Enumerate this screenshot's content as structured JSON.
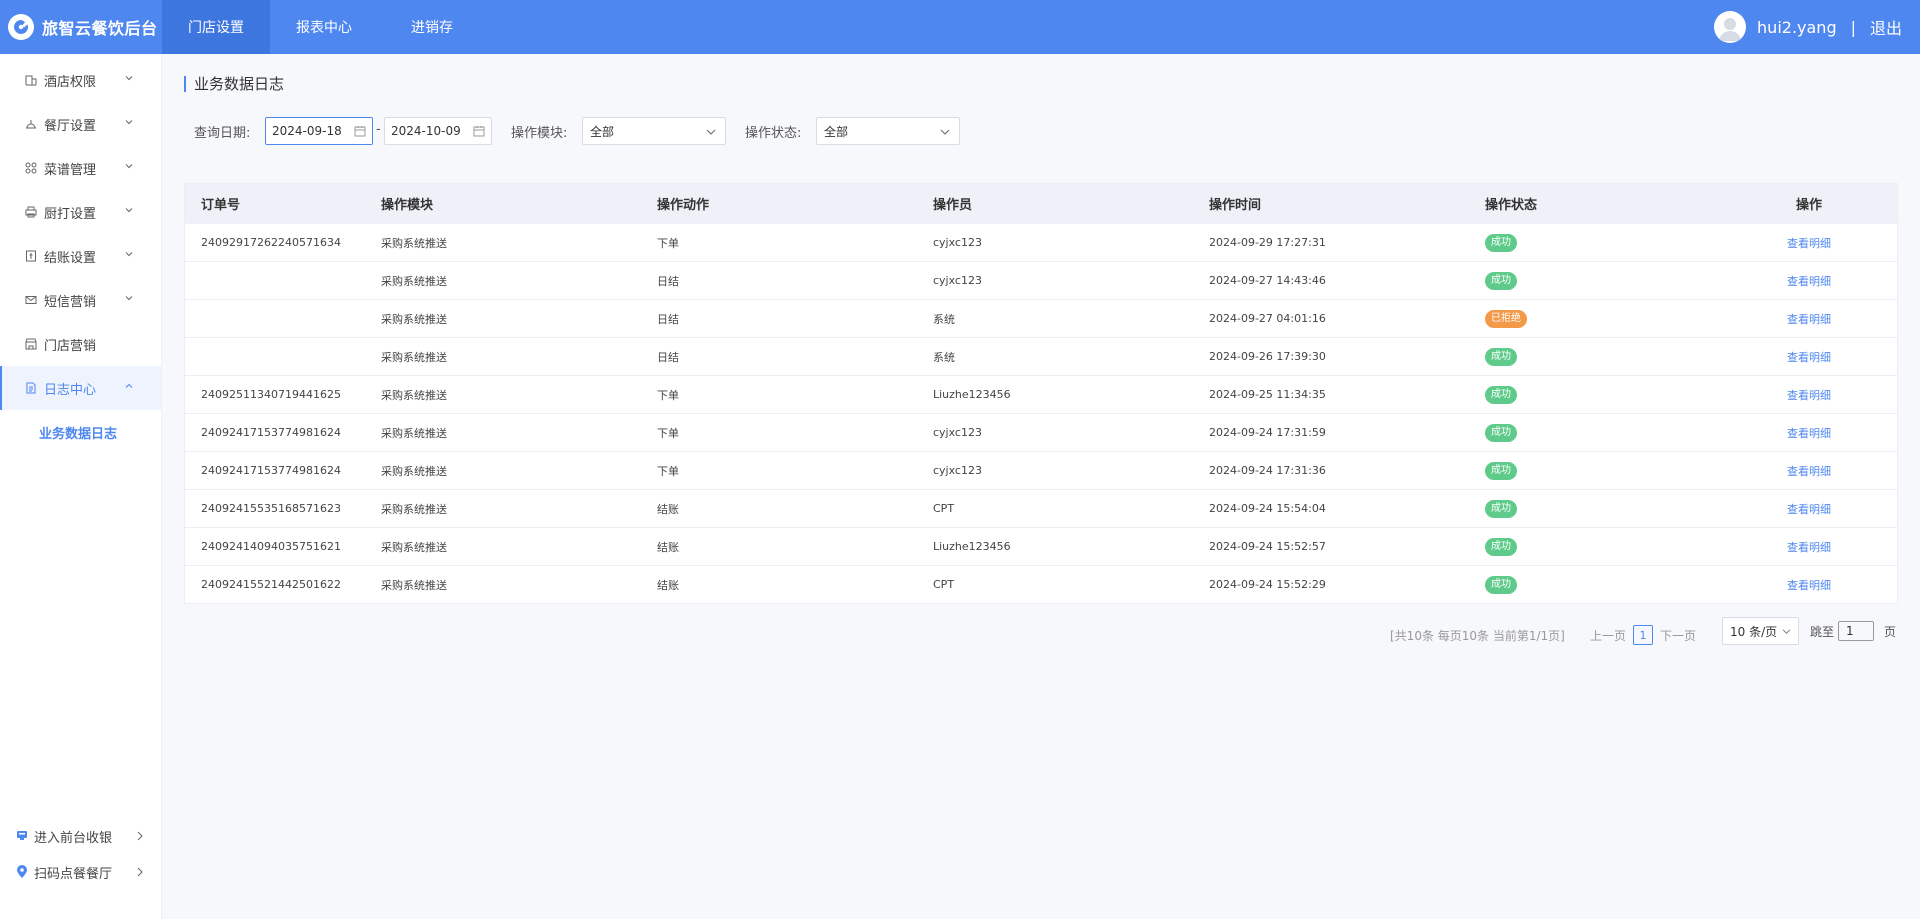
{
  "app": {
    "title": "旅智云餐饮后台"
  },
  "topnav": {
    "tabs": [
      "门店设置",
      "报表中心",
      "进销存"
    ],
    "active_index": 0
  },
  "user": {
    "name": "hui2.yang",
    "separator": "|",
    "logout": "退出"
  },
  "sidebar": {
    "items": [
      {
        "label": "酒店权限",
        "icon": "hotel-icon"
      },
      {
        "label": "餐厅设置",
        "icon": "restaurant-icon"
      },
      {
        "label": "菜谱管理",
        "icon": "menu-grid-icon"
      },
      {
        "label": "厨打设置",
        "icon": "printer-icon"
      },
      {
        "label": "结账设置",
        "icon": "checkout-icon"
      },
      {
        "label": "短信营销",
        "icon": "mail-icon"
      },
      {
        "label": "门店营销",
        "icon": "store-icon"
      },
      {
        "label": "日志中心",
        "icon": "log-icon"
      }
    ],
    "active_sub": "业务数据日志",
    "bottom": [
      {
        "label": "进入前台收银",
        "icon": "cashier-icon"
      },
      {
        "label": "扫码点餐餐厅",
        "icon": "location-pin-icon"
      }
    ]
  },
  "page": {
    "title": "业务数据日志",
    "filters": {
      "date_label": "查询日期:",
      "date_start": "2024-09-18",
      "date_dash": "-",
      "date_end": "2024-10-09",
      "module_label": "操作模块:",
      "module_value": "全部",
      "status_label": "操作状态:",
      "status_value": "全部"
    }
  },
  "table": {
    "headers": [
      "订单号",
      "操作模块",
      "操作动作",
      "操作员",
      "操作时间",
      "操作状态",
      "操作"
    ],
    "rows": [
      {
        "order": "24092917262240571634",
        "module": "采购系统推送",
        "action": "下单",
        "operator": "cyjxc123",
        "time": "2024-09-29 17:27:31",
        "status": "成功",
        "status_type": "ok",
        "op": "查看明细"
      },
      {
        "order": "",
        "module": "采购系统推送",
        "action": "日结",
        "operator": "cyjxc123",
        "time": "2024-09-27 14:43:46",
        "status": "成功",
        "status_type": "ok",
        "op": "查看明细"
      },
      {
        "order": "",
        "module": "采购系统推送",
        "action": "日结",
        "operator": "系统",
        "time": "2024-09-27 04:01:16",
        "status": "已拒绝",
        "status_type": "rej",
        "op": "查看明细"
      },
      {
        "order": "",
        "module": "采购系统推送",
        "action": "日结",
        "operator": "系统",
        "time": "2024-09-26 17:39:30",
        "status": "成功",
        "status_type": "ok",
        "op": "查看明细"
      },
      {
        "order": "24092511340719441625",
        "module": "采购系统推送",
        "action": "下单",
        "operator": "Liuzhe123456",
        "time": "2024-09-25 11:34:35",
        "status": "成功",
        "status_type": "ok",
        "op": "查看明细"
      },
      {
        "order": "24092417153774981624",
        "module": "采购系统推送",
        "action": "下单",
        "operator": "cyjxc123",
        "time": "2024-09-24 17:31:59",
        "status": "成功",
        "status_type": "ok",
        "op": "查看明细"
      },
      {
        "order": "24092417153774981624",
        "module": "采购系统推送",
        "action": "下单",
        "operator": "cyjxc123",
        "time": "2024-09-24 17:31:36",
        "status": "成功",
        "status_type": "ok",
        "op": "查看明细"
      },
      {
        "order": "24092415535168571623",
        "module": "采购系统推送",
        "action": "结账",
        "operator": "CPT",
        "time": "2024-09-24 15:54:04",
        "status": "成功",
        "status_type": "ok",
        "op": "查看明细"
      },
      {
        "order": "24092414094035751621",
        "module": "采购系统推送",
        "action": "结账",
        "operator": "Liuzhe123456",
        "time": "2024-09-24 15:52:57",
        "status": "成功",
        "status_type": "ok",
        "op": "查看明细"
      },
      {
        "order": "24092415521442501622",
        "module": "采购系统推送",
        "action": "结账",
        "operator": "CPT",
        "time": "2024-09-24 15:52:29",
        "status": "成功",
        "status_type": "ok",
        "op": "查看明细"
      }
    ]
  },
  "pagination": {
    "summary": "[共10条 每页10条 当前第1/1页]",
    "prev": "上一页",
    "current": "1",
    "next": "下一页",
    "page_size": "10 条/页",
    "jump_label": "跳至",
    "jump_value": "1",
    "page_suffix": "页"
  },
  "colors": {
    "primary": "#4f87f0",
    "success": "#5fcb8a",
    "rejected": "#f29a48"
  }
}
